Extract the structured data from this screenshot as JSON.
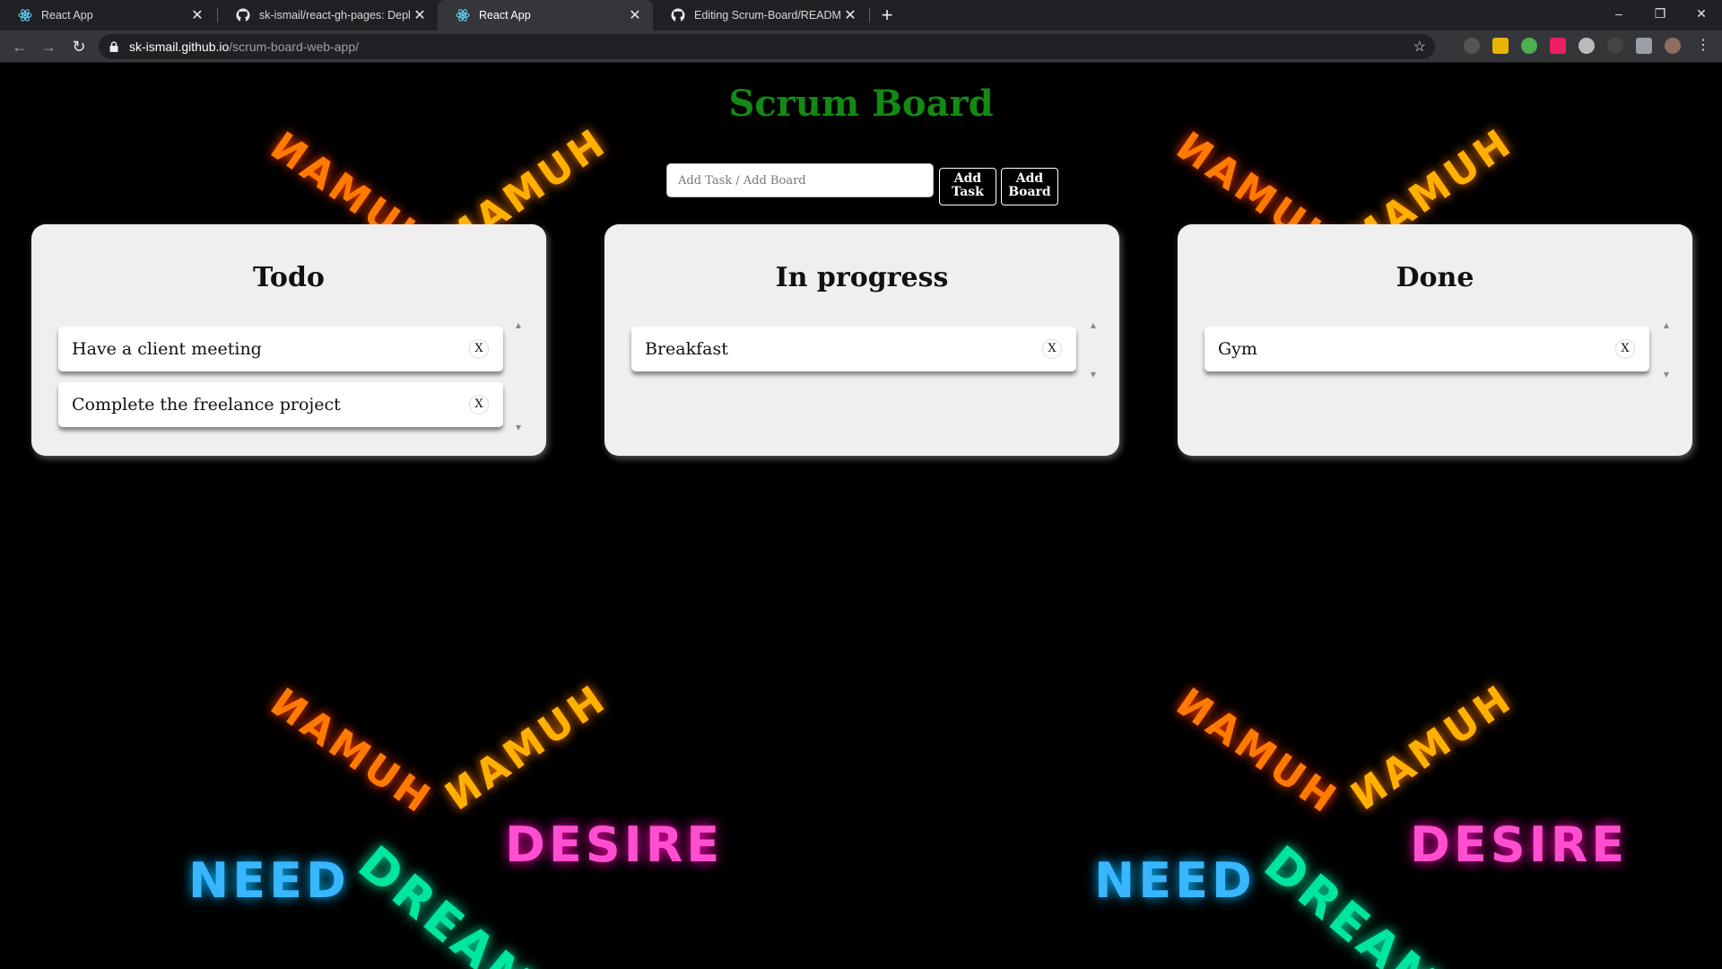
{
  "browser": {
    "tabs": [
      {
        "title": "React App",
        "icon": "react-icon",
        "active": false
      },
      {
        "title": "sk-ismail/react-gh-pages: Deploy",
        "icon": "github-icon",
        "active": false
      },
      {
        "title": "React App",
        "icon": "react-icon",
        "active": true
      },
      {
        "title": "Editing Scrum-Board/README.m",
        "icon": "github-icon",
        "active": false
      }
    ],
    "new_tab": "+",
    "url_host": "sk-ismail.github.io",
    "url_path": "/scrum-board-web-app/",
    "window_controls": {
      "minimize": "–",
      "restore": "❐",
      "close": "✕"
    }
  },
  "app": {
    "title": "Scrum Board",
    "input_placeholder": "Add Task / Add Board",
    "add_task_label": [
      "Add",
      "Task"
    ],
    "add_board_label": [
      "Add",
      "Board"
    ],
    "title_color": "#138a13"
  },
  "boards": [
    {
      "title": "Todo",
      "tasks": [
        "Have a client meeting",
        "Complete the freelance project"
      ]
    },
    {
      "title": "In progress",
      "tasks": [
        "Breakfast"
      ]
    },
    {
      "title": "Done",
      "tasks": [
        "Gym"
      ]
    }
  ],
  "delete_label": "X",
  "background": {
    "neon_words": [
      "HUMAN",
      "HUMAN",
      "DESIRE",
      "NEED",
      "DREAM"
    ]
  }
}
